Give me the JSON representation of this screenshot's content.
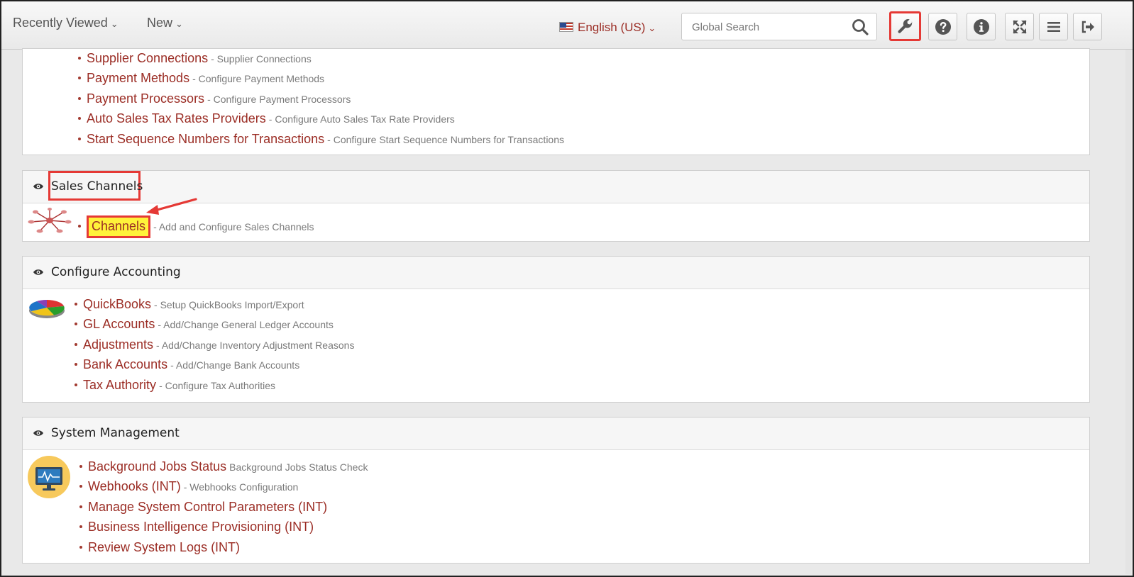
{
  "topbar": {
    "recently_viewed": "Recently Viewed",
    "new": "New",
    "language": "English (US)",
    "search_placeholder": "Global Search"
  },
  "top_section": {
    "items": [
      {
        "label": "Supplier Connections",
        "desc": "- Supplier Connections"
      },
      {
        "label": "Payment Methods",
        "desc": "- Configure Payment Methods"
      },
      {
        "label": "Payment Processors",
        "desc": "- Configure Payment Processors"
      },
      {
        "label": "Auto Sales Tax Rates Providers",
        "desc": "- Configure Auto Sales Tax Rate Providers"
      },
      {
        "label": "Start Sequence Numbers for Transactions",
        "desc": "- Configure Start Sequence Numbers for Transactions"
      }
    ]
  },
  "sales_channels": {
    "title": "Sales Channels",
    "items": [
      {
        "label": "Channels",
        "desc": "- Add and Configure Sales Channels"
      }
    ]
  },
  "configure_accounting": {
    "title": "Configure Accounting",
    "items": [
      {
        "label": "QuickBooks",
        "desc": "- Setup QuickBooks Import/Export"
      },
      {
        "label": "GL Accounts",
        "desc": "- Add/Change General Ledger Accounts"
      },
      {
        "label": "Adjustments",
        "desc": "- Add/Change Inventory Adjustment Reasons"
      },
      {
        "label": "Bank Accounts",
        "desc": "- Add/Change Bank Accounts"
      },
      {
        "label": "Tax Authority",
        "desc": "- Configure Tax Authorities"
      }
    ]
  },
  "system_management": {
    "title": "System Management",
    "items": [
      {
        "label": "Background Jobs Status",
        "desc": "Background Jobs Status Check"
      },
      {
        "label": "Webhooks (INT)",
        "desc": "- Webhooks Configuration"
      },
      {
        "label": "Manage System Control Parameters (INT)",
        "desc": ""
      },
      {
        "label": "Business Intelligence Provisioning (INT)",
        "desc": ""
      },
      {
        "label": "Review System Logs (INT)",
        "desc": ""
      }
    ]
  },
  "icons": [
    "chevron-down-icon",
    "us-flag-icon",
    "search-icon",
    "wrench-icon",
    "help-icon",
    "info-icon",
    "fullscreen-icon",
    "menu-icon",
    "logout-icon",
    "eye-icon",
    "network-icon",
    "pie-chart-icon",
    "monitor-icon",
    "annotation-arrow-icon"
  ],
  "colors": {
    "link": "#9b2d25",
    "highlight_border": "#e53935",
    "highlight_fill": "#fff23a",
    "description": "#7a7a7a"
  }
}
